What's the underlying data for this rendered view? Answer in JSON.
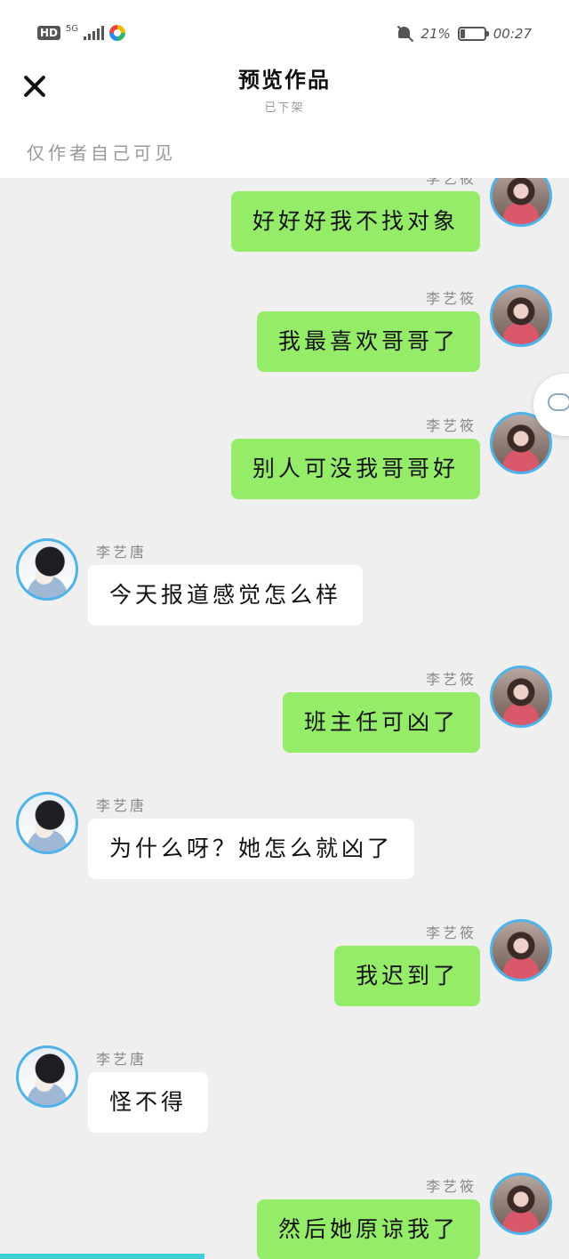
{
  "status_bar": {
    "hd": "HD",
    "network": "5G",
    "battery_percent": "21%",
    "battery_level": 0.21,
    "time": "00:27"
  },
  "header": {
    "title": "预览作品",
    "subtitle": "已下架",
    "visibility_note": "仅作者自己可见"
  },
  "chat": {
    "messages": [
      {
        "side": "right",
        "sender": "李艺筱",
        "text": "好好好我不找对象"
      },
      {
        "side": "right",
        "sender": "李艺筱",
        "text": "我最喜欢哥哥了"
      },
      {
        "side": "right",
        "sender": "李艺筱",
        "text": "别人可没我哥哥好"
      },
      {
        "side": "left",
        "sender": "李艺唐",
        "text": "今天报道感觉怎么样"
      },
      {
        "side": "right",
        "sender": "李艺筱",
        "text": "班主任可凶了"
      },
      {
        "side": "left",
        "sender": "李艺唐",
        "text": "为什么呀？她怎么就凶了"
      },
      {
        "side": "right",
        "sender": "李艺筱",
        "text": "我迟到了"
      },
      {
        "side": "left",
        "sender": "李艺唐",
        "text": "怪不得"
      },
      {
        "side": "right",
        "sender": "李艺筱",
        "text": "然后她原谅我了"
      }
    ]
  },
  "progress": {
    "fraction": 0.36
  },
  "icons": {
    "close": "close-icon",
    "bell": "bell-muted-icon",
    "comment": "comment-bubble-icon"
  }
}
